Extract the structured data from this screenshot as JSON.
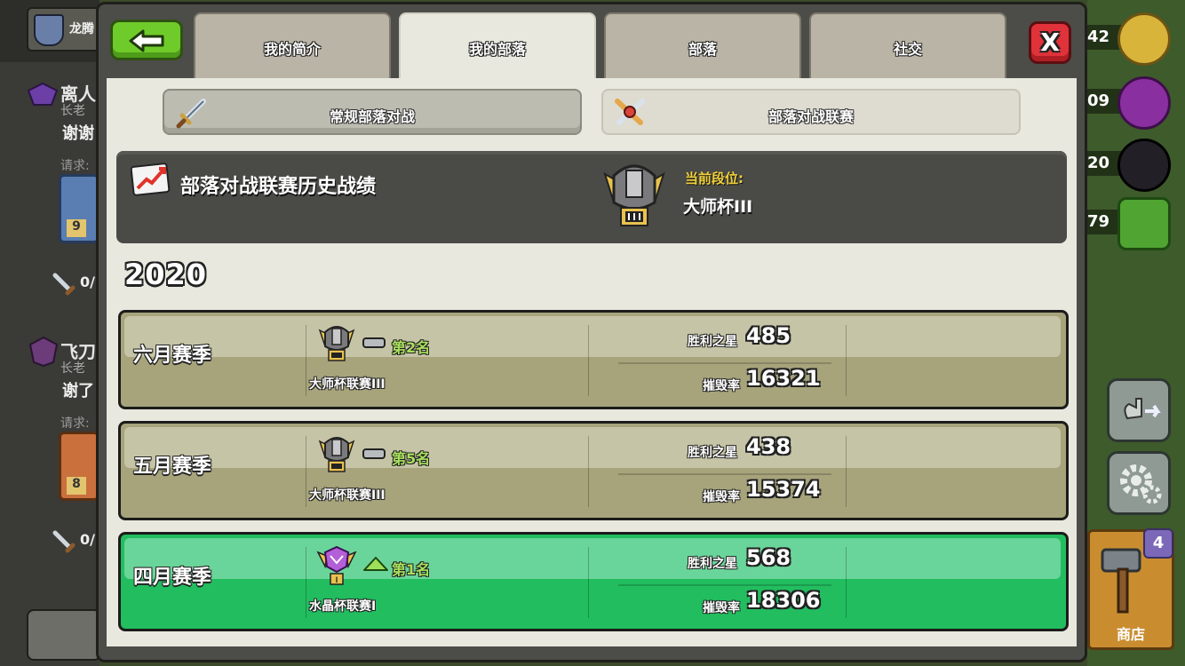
{
  "background": {
    "clan_name": "龙腾",
    "chat": [
      {
        "name": "离人",
        "role": "长老",
        "msg": "谢谢",
        "req": "请求:",
        "level": "9",
        "count": "0/"
      },
      {
        "name": "飞刀",
        "role": "长老",
        "msg": "谢了",
        "req": "请求:",
        "level": "8",
        "count": "0/"
      }
    ],
    "resources": [
      "42",
      "09",
      "20",
      "79"
    ],
    "shop_label": "商店",
    "shop_count": "4"
  },
  "tabs": [
    "我的简介",
    "我的部落",
    "部落",
    "社交"
  ],
  "active_tab": 1,
  "close_label": "X",
  "subtabs": {
    "normal_war": "常规部落对战",
    "war_league": "部落对战联赛"
  },
  "history": {
    "title": "部落对战联赛历史战绩",
    "current_label": "当前段位:",
    "current_value": "大师杯III"
  },
  "year": "2020",
  "seasons": [
    {
      "name": "六月赛季",
      "rank": "第2名",
      "league": "大师杯联赛III",
      "stars_label": "胜利之星",
      "stars": "485",
      "destruction_label": "摧毁率",
      "destruction": "16321",
      "trend": "same",
      "style": "gray"
    },
    {
      "name": "五月赛季",
      "rank": "第5名",
      "league": "大师杯联赛III",
      "stars_label": "胜利之星",
      "stars": "438",
      "destruction_label": "摧毁率",
      "destruction": "15374",
      "trend": "same",
      "style": "gray"
    },
    {
      "name": "四月赛季",
      "rank": "第1名",
      "league": "水晶杯联赛I",
      "stars_label": "胜利之星",
      "stars": "568",
      "destruction_label": "摧毁率",
      "destruction": "18306",
      "trend": "up",
      "style": "green"
    }
  ],
  "colors": {
    "accent_green": "#22bd5f",
    "rank_green": "#a8e05c",
    "gold_label": "#f3d23a",
    "close_red": "#e0323a",
    "back_green": "#6fcb2a"
  }
}
